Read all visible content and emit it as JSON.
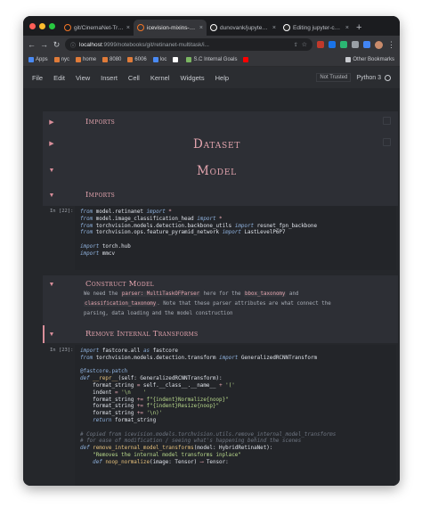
{
  "browser": {
    "tabs": [
      {
        "title": "git/CinemaNet-Traini",
        "fav": "jupyter-icon",
        "fav_color": "#f37626",
        "active": false
      },
      {
        "title": "icevision-mixins-refa",
        "fav": "jupyter-icon",
        "fav_color": "#f37626",
        "active": true
      },
      {
        "title": "dunovank/jupyter-the",
        "fav": "github-icon",
        "fav_color": "#ffffff",
        "active": false
      },
      {
        "title": "Editing jupyter-custo",
        "fav": "github-icon",
        "fav_color": "#ffffff",
        "active": false
      }
    ],
    "new_tab": "+",
    "url_host": "localhost",
    "url_rest": ":9999/notebooks/git/retinanet-multitask/i...",
    "bookmarks": [
      {
        "label": "Apps",
        "color": "#4a8af4"
      },
      {
        "label": "nyc",
        "color": "#e07b39"
      },
      {
        "label": "home",
        "color": "#e07b39"
      },
      {
        "label": "8080",
        "color": "#e07b39"
      },
      {
        "label": "6006",
        "color": "#e07b39"
      },
      {
        "label": "loc",
        "color": "#4a8af4"
      },
      {
        "label": "",
        "color": "#ffffff"
      },
      {
        "label": "S.C Internal Goals",
        "color": "#7bb662"
      },
      {
        "label": "",
        "color": "#ff0000"
      },
      {
        "label": "Other Bookmarks",
        "color": "#c8cacf"
      }
    ]
  },
  "jupyter": {
    "menu": [
      "File",
      "Edit",
      "View",
      "Insert",
      "Cell",
      "Kernel",
      "Widgets",
      "Help"
    ],
    "trust_status": "Not Trusted",
    "kernel": "Python 3"
  },
  "notebook": {
    "imports_collapsed": "Imports",
    "dataset": "Dataset",
    "model": "Model",
    "imports": "Imports",
    "prompt_22": "In [22]:",
    "code_22": [
      [
        [
          "kw",
          "from"
        ],
        [
          "n",
          " model.retinanet "
        ],
        [
          "kw",
          "import"
        ],
        [
          "op",
          " *"
        ]
      ],
      [
        [
          "kw",
          "from"
        ],
        [
          "n",
          " model.image_classification_head "
        ],
        [
          "kw",
          "import"
        ],
        [
          "op",
          " *"
        ]
      ],
      [
        [
          "kw",
          "from"
        ],
        [
          "n",
          " torchvision.models.detection.backbone_utils "
        ],
        [
          "kw",
          "import"
        ],
        [
          "n",
          " resnet_fpn_backbone"
        ]
      ],
      [
        [
          "kw",
          "from"
        ],
        [
          "n",
          " torchvision.ops.feature_pyramid_network "
        ],
        [
          "kw",
          "import"
        ],
        [
          "n",
          " LastLevelP6P7"
        ]
      ],
      [
        [
          "n",
          ""
        ]
      ],
      [
        [
          "kw",
          "import"
        ],
        [
          "n",
          " torch.hub"
        ]
      ],
      [
        [
          "kw",
          "import"
        ],
        [
          "n",
          " mmcv"
        ]
      ]
    ],
    "construct_model": "Construct Model",
    "md_we_need": "We need the",
    "md_parser_code": "parser: MultiTaskOFParser",
    "md_here_for": "here for the",
    "md_bbox_code": "bbox_taxonomy",
    "md_and": "and",
    "md_cls_code": "classification_taxonomy",
    "md_rest": ". Note that these parser attributes are what connect the",
    "md_line3": "parsing, data loading and the model construction",
    "remove_transforms": "Remove Internal Transforms",
    "prompt_23": "In [23]:",
    "code_23": [
      [
        [
          "kw",
          "import"
        ],
        [
          "n",
          " fastcore.all "
        ],
        [
          "kw",
          "as"
        ],
        [
          "n",
          " fastcore"
        ]
      ],
      [
        [
          "kw",
          "from"
        ],
        [
          "n",
          " torchvision.models.detection.transform "
        ],
        [
          "kw",
          "import"
        ],
        [
          "n",
          " GeneralizedRCNNTransform"
        ]
      ],
      [
        [
          "n",
          ""
        ]
      ],
      [
        [
          "dec",
          "@fastcore.patch"
        ]
      ],
      [
        [
          "kw",
          "def"
        ],
        [
          "fn",
          " __repr__"
        ],
        [
          "n",
          "(self: GeneralizedRCNNTransform):"
        ]
      ],
      [
        [
          "n",
          "    format_string "
        ],
        [
          "op",
          "="
        ],
        [
          "n",
          " self.__class__.__name__ "
        ],
        [
          "op",
          "+"
        ],
        [
          "str",
          " '('"
        ]
      ],
      [
        [
          "n",
          "    indent "
        ],
        [
          "op",
          "="
        ],
        [
          "str",
          " '\\n    '"
        ]
      ],
      [
        [
          "n",
          "    format_string "
        ],
        [
          "op",
          "+="
        ],
        [
          "str",
          " f\"{indent}Normalize{noop}\""
        ]
      ],
      [
        [
          "n",
          "    format_string "
        ],
        [
          "op",
          "+="
        ],
        [
          "str",
          " f\"{indent}Resize{noop}\""
        ]
      ],
      [
        [
          "n",
          "    format_string "
        ],
        [
          "op",
          "+="
        ],
        [
          "str",
          " '\\n)'"
        ]
      ],
      [
        [
          "kw",
          "    return"
        ],
        [
          "n",
          " format_string"
        ]
      ],
      [
        [
          "n",
          ""
        ]
      ],
      [
        [
          "cm",
          "# Copied from icevision.models.torchvision.utils.remove_internal_model_transforms"
        ]
      ],
      [
        [
          "cm",
          "# for ease of modification / seeing what's happening behind the scenes"
        ]
      ],
      [
        [
          "kw",
          "def"
        ],
        [
          "fn",
          " remove_internal_model_transforms"
        ],
        [
          "n",
          "(model: HybridRetinaNet):"
        ]
      ],
      [
        [
          "str",
          "    \"Removes the internal model transforms inplace\""
        ]
      ],
      [
        [
          "kw",
          "    def"
        ],
        [
          "fn",
          " noop_normalize"
        ],
        [
          "n",
          "(image: Tensor) "
        ],
        [
          "op",
          "⟶"
        ],
        [
          "n",
          " Tensor:"
        ]
      ]
    ]
  }
}
